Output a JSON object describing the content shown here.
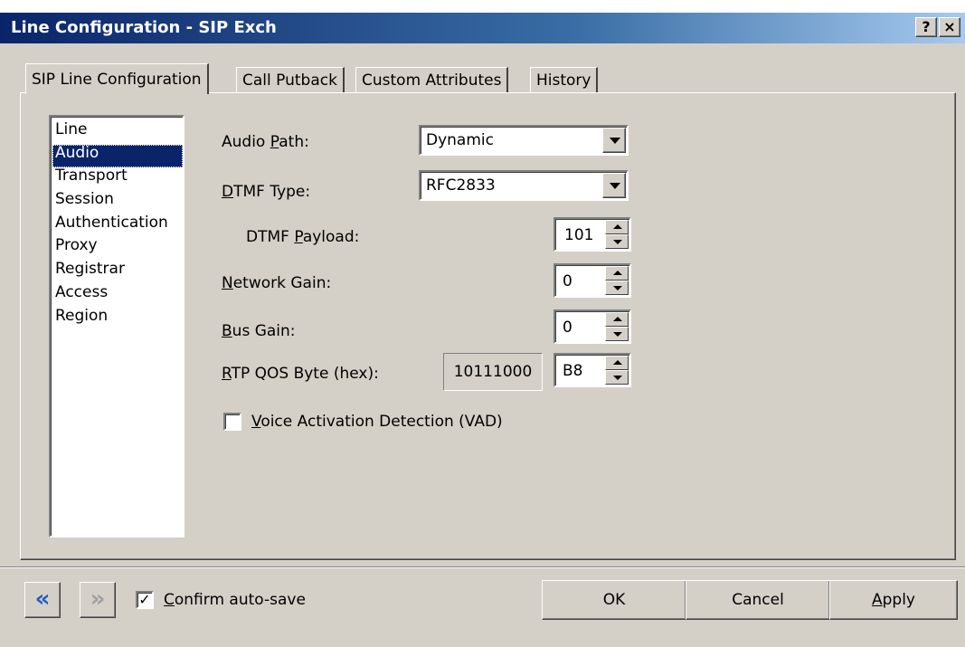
{
  "window": {
    "title": "Line Configuration - SIP Exch",
    "help_glyph": "?",
    "close_glyph": "×"
  },
  "tabs": [
    {
      "label": "SIP Line Configuration",
      "active": true
    },
    {
      "label": "Call Putback",
      "active": false
    },
    {
      "label": "Custom Attributes",
      "active": false
    },
    {
      "label": "History",
      "active": false
    }
  ],
  "sections": {
    "items": [
      "Line",
      "Audio",
      "Transport",
      "Session",
      "Authentication",
      "Proxy",
      "Registrar",
      "Access",
      "Region"
    ],
    "selected": "Audio"
  },
  "form": {
    "audio_path": {
      "label_pre": "Audio ",
      "label_key": "P",
      "label_post": "ath:",
      "value": "Dynamic"
    },
    "dtmf_type": {
      "label_pre": "",
      "label_key": "D",
      "label_post": "TMF Type:",
      "value": "RFC2833"
    },
    "dtmf_payload": {
      "label_pre": "DTMF ",
      "label_key": "P",
      "label_post": "ayload:",
      "value": "101"
    },
    "network_gain": {
      "label_pre": "",
      "label_key": "N",
      "label_post": "etwork Gain:",
      "value": "0"
    },
    "bus_gain": {
      "label_pre": "",
      "label_key": "B",
      "label_post": "us Gain:",
      "value": "0"
    },
    "rtp_qos": {
      "label_pre": "",
      "label_key": "R",
      "label_post": "TP QOS Byte (hex):",
      "binary": "10111000",
      "value": "B8"
    },
    "vad": {
      "label_pre": "",
      "label_key": "V",
      "label_post": "oice Activation Detection (VAD)",
      "checked": false
    }
  },
  "footer": {
    "prev_glyph": "«",
    "next_glyph": "»",
    "confirm": {
      "label_key": "C",
      "label_post": "onfirm auto-save",
      "checked": true,
      "check_glyph": "✓"
    },
    "ok_label": "OK",
    "cancel_label": "Cancel",
    "apply_label_key": "A",
    "apply_label_post": "pply"
  },
  "colors": {
    "title_start": "#0a246a",
    "title_end": "#a6caf0",
    "selection": "#0a246a",
    "nav_prev": "#1f5fbf",
    "nav_next_disabled": "#a0a0a0"
  }
}
